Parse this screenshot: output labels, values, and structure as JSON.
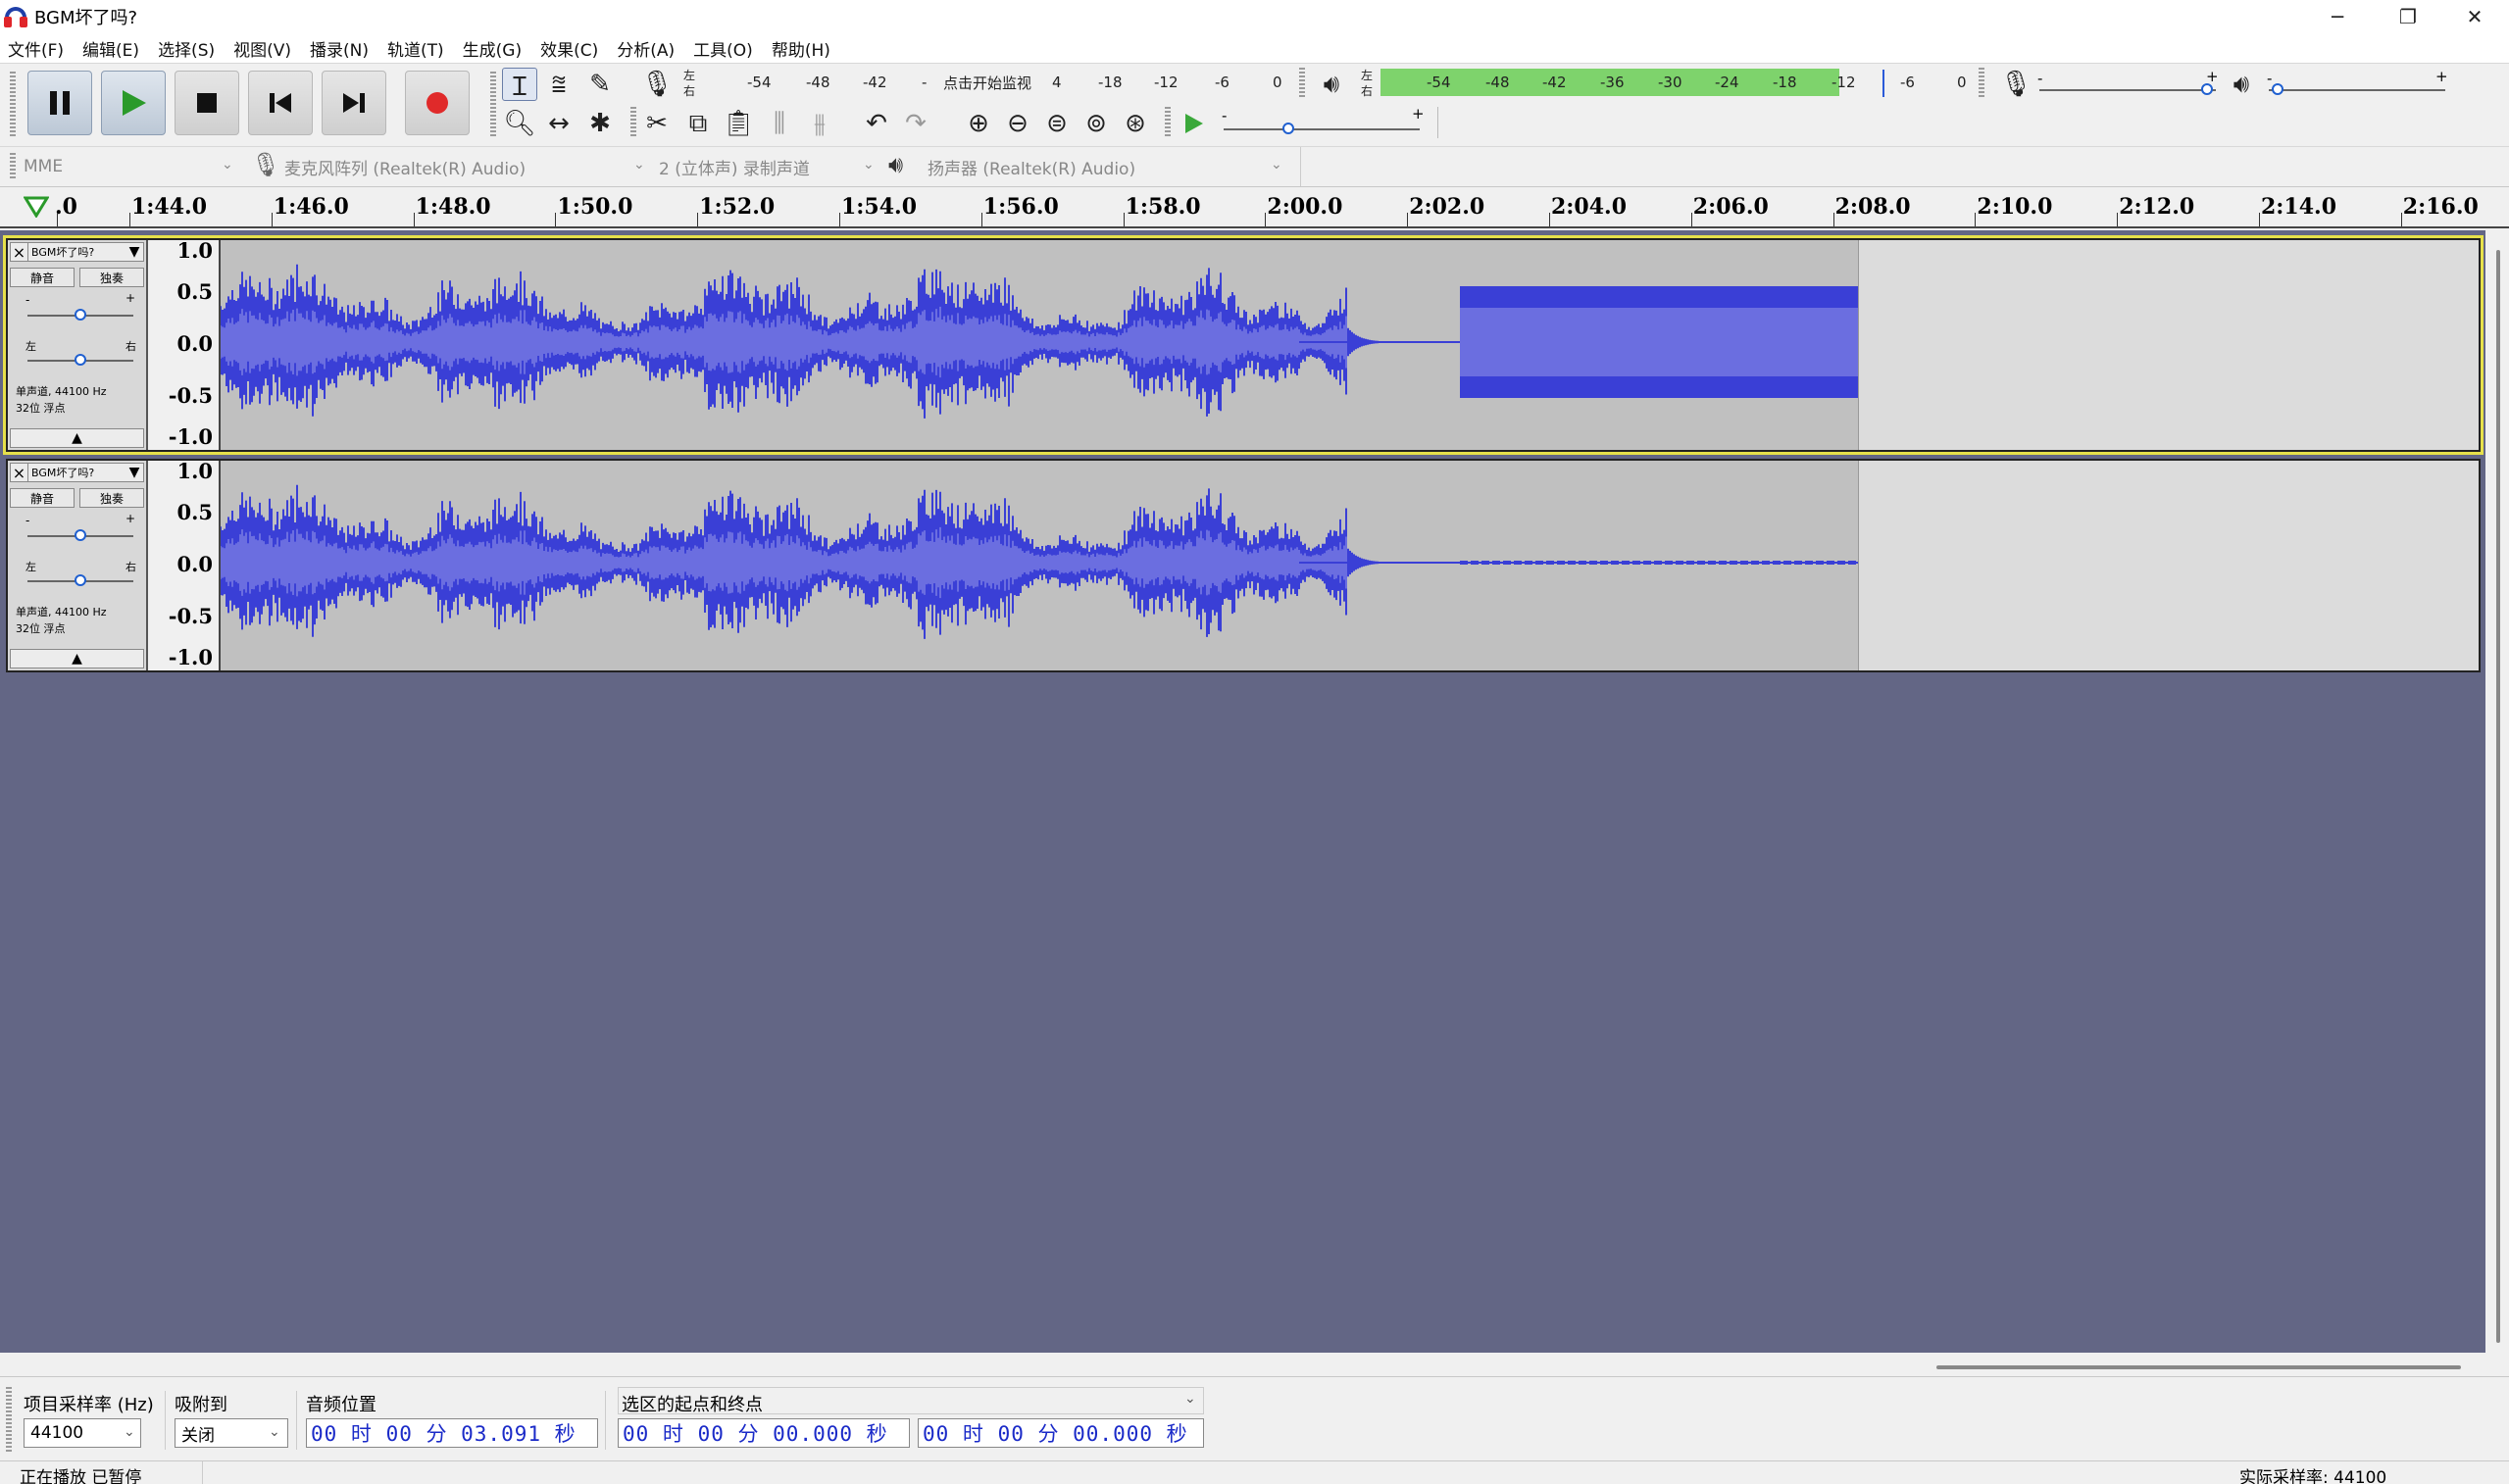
{
  "window": {
    "title": "BGM坏了吗?",
    "minimize": "─",
    "maximize": "❐",
    "close": "✕"
  },
  "menu": [
    "文件(F)",
    "编辑(E)",
    "选择(S)",
    "视图(V)",
    "播录(N)",
    "轨道(T)",
    "生成(G)",
    "效果(C)",
    "分析(A)",
    "工具(O)",
    "帮助(H)"
  ],
  "transport": {
    "pause": "pause-icon",
    "play": "play-icon",
    "stop": "stop-icon",
    "skip_start": "skip-start-icon",
    "skip_end": "skip-end-icon",
    "record": "record-icon"
  },
  "colors": {
    "waveform": "#3a3fd6",
    "waveform_rms": "#6b6ee0",
    "record": "#e02a2a",
    "play": "#2a9a2a",
    "meter": "#7ed36c",
    "workspace": "#636685",
    "selection_border": "#e6e04a"
  },
  "record_meter": {
    "lr": [
      "左",
      "右"
    ],
    "ticks": [
      "-54",
      "-48",
      "-42",
      "-",
      "点击开始监视",
      "4",
      "-18",
      "-12",
      "-6",
      "0"
    ]
  },
  "play_meter": {
    "lr": [
      "左",
      "右"
    ],
    "ticks": [
      "-54",
      "-48",
      "-42",
      "-36",
      "-30",
      "-24",
      "-18",
      "-12",
      "-6",
      "0"
    ],
    "level_fraction": 0.78
  },
  "mixer": {
    "rec_minus": "-",
    "rec_plus": "+",
    "play_minus": "-",
    "play_plus": "+",
    "rec_level": 0.95,
    "play_level": 0.05
  },
  "play_at_speed": {
    "minus": "-",
    "plus": "+",
    "level": 0.33
  },
  "devices": {
    "host": "MME",
    "input": "麦克风阵列 (Realtek(R) Audio)",
    "channels": "2 (立体声) 录制声道",
    "output": "扬声器 (Realtek(R) Audio)"
  },
  "timeline": {
    "labels": [
      ".0",
      "1:44.0",
      "1:46.0",
      "1:48.0",
      "1:50.0",
      "1:52.0",
      "1:54.0",
      "1:56.0",
      "1:58.0",
      "2:00.0",
      "2:02.0",
      "2:04.0",
      "2:06.0",
      "2:08.0",
      "2:10.0",
      "2:12.0",
      "2:14.0",
      "2:16.0"
    ]
  },
  "tracks": [
    {
      "name": "BGM坏了吗?",
      "mute": "静音",
      "solo": "独奏",
      "gain_minus": "-",
      "gain_plus": "+",
      "pan_left": "左",
      "pan_right": "右",
      "info_line1": "单声道, 44100 Hz",
      "info_line2": "32位 浮点",
      "scale": [
        "1.0",
        "0.5",
        "0.0",
        "-0.5",
        "-1.0"
      ],
      "selected": true
    },
    {
      "name": "BGM坏了吗?",
      "mute": "静音",
      "solo": "独奏",
      "gain_minus": "-",
      "gain_plus": "+",
      "pan_left": "左",
      "pan_right": "右",
      "info_line1": "单声道, 44100 Hz",
      "info_line2": "32位 浮点",
      "scale": [
        "1.0",
        "0.5",
        "0.0",
        "-0.5",
        "-1.0"
      ],
      "selected": false
    }
  ],
  "selection": {
    "rate_label": "项目采样率 (Hz)",
    "rate_value": "44100",
    "snap_label": "吸附到",
    "snap_value": "关闭",
    "pos_label": "音频位置",
    "pos_value": "00 时 00 分 03.091 秒",
    "range_label": "选区的起点和终点",
    "start_value": "00 时 00 分 00.000 秒",
    "end_value": "00 时 00 分 00.000 秒"
  },
  "status": {
    "left": "正在播放 已暂停",
    "right": "实际采样率: 44100"
  }
}
